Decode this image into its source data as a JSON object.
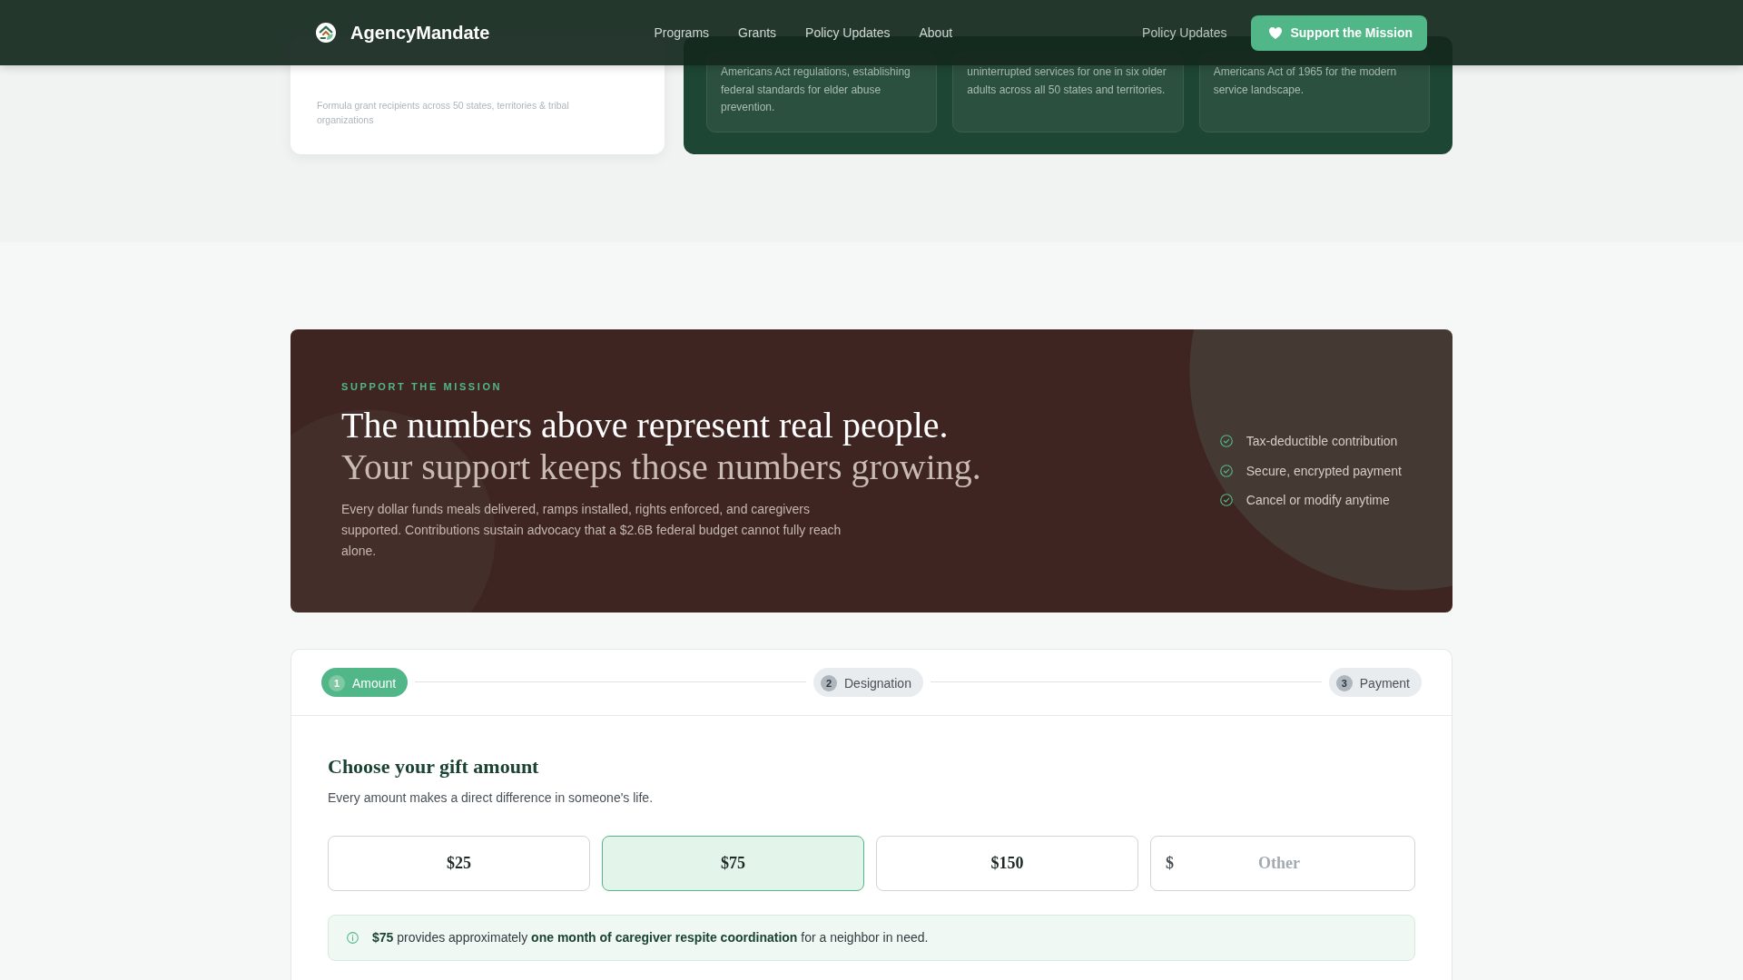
{
  "nav": {
    "brand": "AgencyMandate",
    "links": [
      "Programs",
      "Grants",
      "Policy Updates",
      "About"
    ],
    "secondary_link": "Policy Updates",
    "cta": "Support the Mission"
  },
  "overview": {
    "stat_card": {
      "caption": "Formula grant recipients across 50 states, territories & tribal organizations"
    },
    "feature_cards": [
      {
        "text": "Americans Act regulations, establishing federal standards for elder abuse prevention."
      },
      {
        "text": "uninterrupted services for one in six older adults across all 50 states and territories."
      },
      {
        "text": "Americans Act of 1965 for the modern service landscape."
      }
    ]
  },
  "support": {
    "eyebrow": "SUPPORT THE MISSION",
    "headline": "The numbers above represent real people.",
    "headline_muted": "Your support keeps those numbers growing.",
    "body": "Every dollar funds meals delivered, ramps installed, rights enforced, and caregivers supported. Contributions sustain advocacy that a $2.6B federal budget cannot fully reach alone.",
    "assurances": [
      "Tax-deductible contribution",
      "Secure, encrypted payment",
      "Cancel or modify anytime"
    ]
  },
  "donation": {
    "steps": [
      {
        "number": "1",
        "label": "Amount",
        "selected": true
      },
      {
        "number": "2",
        "label": "Designation",
        "selected": false
      },
      {
        "number": "3",
        "label": "Payment",
        "selected": false
      }
    ],
    "title": "Choose your gift amount",
    "subtitle": "Every amount makes a direct difference in someone's life.",
    "amounts": [
      {
        "kind": "preset",
        "label": "$25",
        "selected": false
      },
      {
        "kind": "preset",
        "label": "$75",
        "selected": true
      },
      {
        "kind": "preset",
        "label": "$150",
        "selected": false
      },
      {
        "kind": "custom",
        "prefix": "$",
        "placeholder": "Other",
        "selected": false
      }
    ],
    "impact_note": "**$75** provides approximately **one month of caregiver respite coordination** for a neighbor in need."
  }
}
